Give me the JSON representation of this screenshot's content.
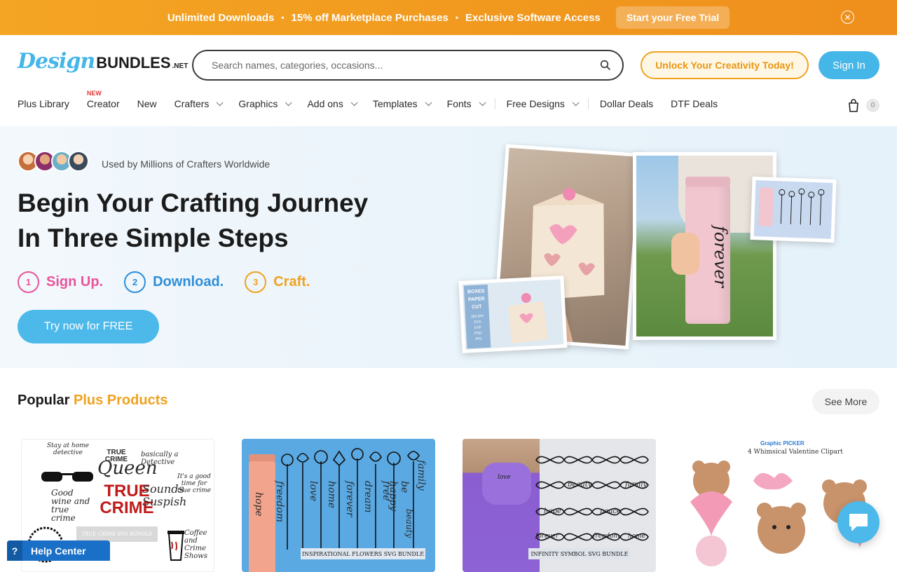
{
  "promo": {
    "item1": "Unlimited Downloads",
    "item2": "15% off Marketplace Purchases",
    "item3": "Exclusive Software Access",
    "dot": "•",
    "trial_label": "Start your Free Trial",
    "close_glyph": "✕"
  },
  "header": {
    "logo_design": "Design",
    "logo_bundles": "BUNDLES",
    "logo_net": ".NET",
    "search_placeholder": "Search names, categories, occasions...",
    "unlock_label": "Unlock Your Creativity Today!",
    "signin_label": "Sign In",
    "cart_count": "0"
  },
  "nav": {
    "items": [
      {
        "label": "Plus Library",
        "dropdown": false
      },
      {
        "label": "Creator",
        "dropdown": false,
        "tag": "NEW"
      },
      {
        "label": "New",
        "dropdown": false
      },
      {
        "label": "Crafters",
        "dropdown": true
      },
      {
        "label": "Graphics",
        "dropdown": true
      },
      {
        "label": "Add ons",
        "dropdown": true
      },
      {
        "label": "Templates",
        "dropdown": true
      },
      {
        "label": "Fonts",
        "dropdown": true
      },
      {
        "label": "Free Designs",
        "dropdown": true
      },
      {
        "label": "Dollar Deals",
        "dropdown": false
      },
      {
        "label": "DTF Deals",
        "dropdown": false
      }
    ]
  },
  "hero": {
    "used_by": "Used by Millions of Crafters Worldwide",
    "title_line1": "Begin Your Crafting Journey",
    "title_line2": "In Three Simple Steps",
    "steps": [
      {
        "num": "1",
        "label": "Sign Up.",
        "color": "#e9549b"
      },
      {
        "num": "2",
        "label": "Download.",
        "color": "#2e8ed8"
      },
      {
        "num": "3",
        "label": "Craft.",
        "color": "#f0a21f"
      }
    ],
    "cta_label": "Try now for FREE",
    "photo_box_caption": [
      "BOXES",
      "PAPER",
      "CUT"
    ],
    "photo_box_formats": [
      "300 DPI",
      "SVG",
      "DXF",
      "PNG",
      "JPG"
    ],
    "photo_tumbler_word": "forever"
  },
  "popular": {
    "title_prefix": "Popular",
    "title_highlight": "Plus Products",
    "see_more": "See More",
    "cards": [
      {
        "caption": "TRUE CRIME SVG BUNDLE",
        "words": [
          "TRUE CRIME",
          "Queen",
          "basically a Detective",
          "It's a good time for true crime",
          "Sounds Suspish",
          "Coffee and Crime Shows",
          "TRUE CRIME",
          "Good wine and true crime",
          "Stay at home detective"
        ]
      },
      {
        "caption": "INSPIRATIONAL FLOWERS SVG BUNDLE",
        "words": [
          "hope",
          "freedom",
          "love",
          "home",
          "forever",
          "dream",
          "free",
          "be happy",
          "family",
          "beauty"
        ]
      },
      {
        "caption": "INFINITY SYMBOL SVG BUNDLE",
        "words": [
          "love",
          "beauty",
          "family",
          "hope",
          "peace",
          "forever",
          "freedom",
          "home"
        ]
      },
      {
        "caption": "4 Whimsical Valentine Clipart",
        "brand": "Graphic PICKER"
      }
    ]
  },
  "help": {
    "q": "?",
    "label": "Help Center"
  },
  "colors": {
    "accent_blue": "#45b6e8",
    "accent_orange": "#f0a21f",
    "accent_pink": "#e9549b"
  }
}
